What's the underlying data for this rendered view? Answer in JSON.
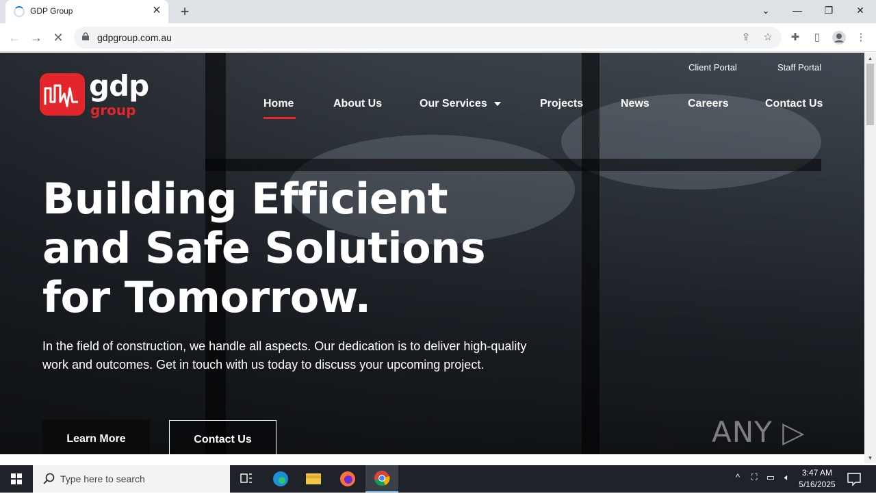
{
  "browser": {
    "tab_title": "GDP Group",
    "tab_close": "✕",
    "new_tab": "+",
    "url": "gdpgroup.com.au",
    "back": "←",
    "forward": "→",
    "reload": "✕",
    "window_controls": {
      "menu": "⌄",
      "minimize": "—",
      "restore": "❐",
      "close": "✕"
    }
  },
  "site": {
    "logo": {
      "gdp": "gdp",
      "group": "group"
    },
    "portals": [
      "Client Portal",
      "Staff Portal"
    ],
    "nav": [
      "Home",
      "About Us",
      "Our Services",
      "Projects",
      "News",
      "Careers",
      "Contact Us"
    ],
    "headline": "Building Efficient and Safe Solutions for Tomorrow.",
    "subtext": "In the field of construction, we handle all aspects. Our dedication is to deliver high-quality work and outcomes. Get in touch with us today to discuss your upcoming project.",
    "buttons": {
      "learn_more": "Learn More",
      "contact_us": "Contact Us"
    },
    "watermark": "ANY ▷ RUN",
    "accent_color": "#e2262b"
  },
  "taskbar": {
    "search_placeholder": "Type here to search",
    "time": "3:47 AM",
    "date": "5/16/2025"
  }
}
